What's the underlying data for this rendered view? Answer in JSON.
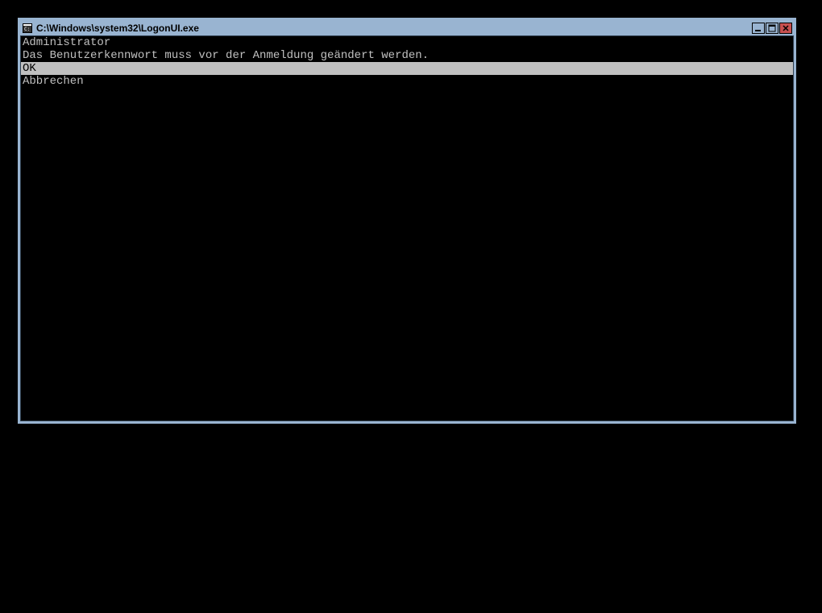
{
  "window": {
    "title": "C:\\Windows\\system32\\LogonUI.exe"
  },
  "console": {
    "user_line": "Administrator",
    "message_line": "Das Benutzerkennwort muss vor der Anmeldung geändert werden.",
    "ok_line": "OK",
    "cancel_line": "Abbrechen"
  }
}
